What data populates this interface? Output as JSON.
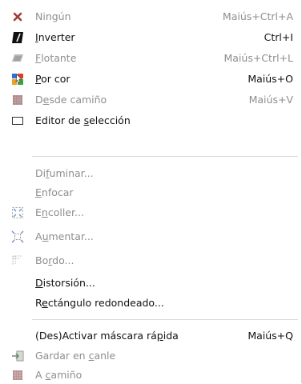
{
  "menu": {
    "items": [
      {
        "pre": "Ningún",
        "acc": "",
        "post": "",
        "shortcut": "Maiús+Ctrl+A",
        "icon": "x-icon",
        "enabled": false
      },
      {
        "pre": "",
        "acc": "I",
        "post": "nverter",
        "shortcut": "Ctrl+I",
        "icon": "invert-selection-icon",
        "enabled": true
      },
      {
        "pre": "",
        "acc": "F",
        "post": "lotante",
        "shortcut": "Maiús+Ctrl+L",
        "icon": "floating-selection-icon",
        "enabled": false
      },
      {
        "pre": "",
        "acc": "P",
        "post": "or cor",
        "shortcut": "Maiús+O",
        "icon": "select-by-color-icon",
        "enabled": true
      },
      {
        "pre": "D",
        "acc": "e",
        "post": "sde camiño",
        "shortcut": "Maiús+V",
        "icon": "selection-from-path-icon",
        "enabled": false
      },
      {
        "pre": "Editor de ",
        "acc": "s",
        "post": "elección",
        "shortcut": "",
        "icon": "selection-editor-icon",
        "enabled": true
      },
      {
        "pre": "Di",
        "acc": "f",
        "post": "uminar...",
        "shortcut": "",
        "icon": "",
        "enabled": false
      },
      {
        "pre": "",
        "acc": "E",
        "post": "nfocar",
        "shortcut": "",
        "icon": "",
        "enabled": false
      },
      {
        "pre": "E",
        "acc": "n",
        "post": "coller...",
        "shortcut": "",
        "icon": "shrink-selection-icon",
        "enabled": false
      },
      {
        "pre": "A",
        "acc": "u",
        "post": "mentar...",
        "shortcut": "",
        "icon": "grow-selection-icon",
        "enabled": false
      },
      {
        "pre": "Bo",
        "acc": "r",
        "post": "do...",
        "shortcut": "",
        "icon": "border-selection-icon",
        "enabled": false
      },
      {
        "pre": "",
        "acc": "D",
        "post": "istorsión...",
        "shortcut": "",
        "icon": "",
        "enabled": true
      },
      {
        "pre": "R",
        "acc": "e",
        "post": "ctángulo redondeado...",
        "shortcut": "",
        "icon": "",
        "enabled": true
      },
      {
        "pre": "(Des)Activar máscara rá",
        "acc": "p",
        "post": "ida",
        "shortcut": "Maiús+Q",
        "icon": "",
        "enabled": true
      },
      {
        "pre": "Gardar en ",
        "acc": "c",
        "post": "anle",
        "shortcut": "",
        "icon": "save-to-channel-icon",
        "enabled": false
      },
      {
        "pre": "A ",
        "acc": "c",
        "post": "amiño",
        "shortcut": "",
        "icon": "selection-to-path-icon",
        "enabled": false
      }
    ]
  }
}
